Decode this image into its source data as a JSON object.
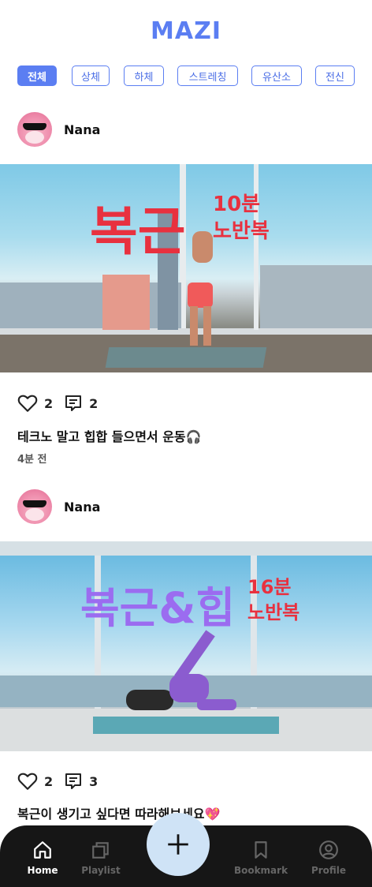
{
  "app": {
    "title": "MAZI"
  },
  "categories": [
    {
      "label": "전체",
      "active": true
    },
    {
      "label": "상체",
      "active": false
    },
    {
      "label": "하체",
      "active": false
    },
    {
      "label": "스트레칭",
      "active": false
    },
    {
      "label": "유산소",
      "active": false
    },
    {
      "label": "전신",
      "active": false
    }
  ],
  "posts": [
    {
      "username": "Nana",
      "overlay_main": "복근",
      "overlay_sub_line1": "10분",
      "overlay_sub_line2": "노반복",
      "likes": "2",
      "comments": "2",
      "caption": "테크노 말고 힙합 들으면서 운동🎧",
      "time_ago": "4분 전"
    },
    {
      "username": "Nana",
      "overlay_main": "복근&힙",
      "overlay_sub_line1": "16분",
      "overlay_sub_line2": "노반복",
      "likes": "2",
      "comments": "3",
      "caption": "복근이 생기고 싶다면 따라해보세요💖"
    }
  ],
  "nav": {
    "home": "Home",
    "playlist": "Playlist",
    "bookmark": "Bookmark",
    "profile": "Profile"
  },
  "colors": {
    "brand": "#5b7ef2",
    "overlay_red": "#e8313f",
    "overlay_purple": "#9b6cf0",
    "nav_bg": "#161616",
    "fab_bg": "#cfe3f6"
  }
}
